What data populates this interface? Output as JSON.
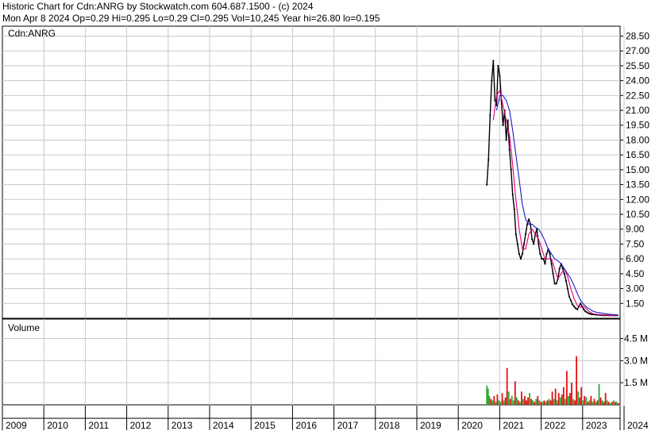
{
  "header": {
    "line1": "Historic Chart for Cdn:ANRG by Stockwatch.com 604.687.1500 - (c) 2024",
    "line2": "Mon Apr  8 2024  Op=0.29  Hi=0.295  Lo=0.29  Cl=0.295  Vol=10,245  Year hi=26.80  lo=0.195"
  },
  "colors": {
    "grid": "#c8c8c8",
    "price": "#000000",
    "ma_short": "#e0007a",
    "ma_long": "#1a1acc",
    "vol_up": "#2ea82e",
    "vol_down": "#e01010"
  },
  "chart_data": [
    {
      "type": "line",
      "panel": "price",
      "title": "Cdn:ANRG",
      "y_ticks": [
        "28.50",
        "27.00",
        "25.50",
        "24.00",
        "22.50",
        "21.00",
        "19.50",
        "18.00",
        "16.50",
        "15.00",
        "13.50",
        "12.00",
        "10.50",
        "9.00",
        "7.50",
        "6.00",
        "4.50",
        "3.00",
        "1.50"
      ],
      "ylim": [
        0,
        29.5
      ],
      "xlim": [
        2009,
        2024.3
      ],
      "grid": true,
      "series": [
        {
          "role": "price",
          "x": [
            2021.0,
            2021.04,
            2021.08,
            2021.12,
            2021.16,
            2021.2,
            2021.24,
            2021.28,
            2021.32,
            2021.36,
            2021.4,
            2021.44,
            2021.48,
            2021.52,
            2021.56,
            2021.6,
            2021.64,
            2021.68,
            2021.72,
            2021.76,
            2021.8,
            2021.84,
            2021.88,
            2021.92,
            2021.96,
            2022.0,
            2022.04,
            2022.08,
            2022.12,
            2022.16,
            2022.2,
            2022.24,
            2022.28,
            2022.32,
            2022.36,
            2022.4,
            2022.44,
            2022.48,
            2022.52,
            2022.56,
            2022.6,
            2022.64,
            2022.68,
            2022.72,
            2022.76,
            2022.8,
            2022.84,
            2022.88,
            2022.92,
            2022.96,
            2023.0,
            2023.04,
            2023.08,
            2023.12,
            2023.16,
            2023.2,
            2023.24,
            2023.28,
            2023.32,
            2023.36,
            2023.4,
            2023.44,
            2023.48,
            2023.52,
            2023.56,
            2023.6,
            2023.64,
            2023.68,
            2023.72,
            2023.76,
            2023.8,
            2023.84,
            2023.88,
            2023.92,
            2023.96,
            2024.0,
            2024.04,
            2024.08,
            2024.12,
            2024.16,
            2024.2,
            2024.24
          ],
          "y": [
            13.5,
            16.0,
            20.5,
            24.0,
            26.0,
            22.0,
            21.5,
            25.5,
            24.5,
            22.0,
            19.5,
            21.0,
            18.0,
            20.0,
            17.0,
            15.0,
            12.5,
            11.0,
            8.5,
            7.5,
            6.5,
            6.0,
            6.5,
            7.5,
            8.5,
            9.5,
            10.0,
            9.5,
            8.0,
            7.5,
            8.5,
            9.0,
            7.5,
            6.5,
            6.0,
            6.0,
            5.5,
            6.5,
            7.0,
            6.5,
            5.5,
            4.5,
            3.5,
            3.5,
            4.0,
            5.0,
            5.5,
            5.0,
            4.5,
            3.8,
            3.0,
            2.2,
            1.8,
            1.4,
            1.2,
            1.0,
            0.9,
            1.2,
            1.5,
            1.2,
            0.9,
            0.7,
            0.6,
            0.5,
            0.45,
            0.4,
            0.4,
            0.38,
            0.35,
            0.35,
            0.33,
            0.32,
            0.3,
            0.3,
            0.3,
            0.3,
            0.29,
            0.3,
            0.3,
            0.29,
            0.295,
            0.295
          ]
        },
        {
          "role": "ma_short",
          "x": [
            2021.16,
            2021.24,
            2021.32,
            2021.4,
            2021.48,
            2021.56,
            2021.64,
            2021.72,
            2021.8,
            2021.88,
            2021.96,
            2022.04,
            2022.12,
            2022.2,
            2022.28,
            2022.36,
            2022.44,
            2022.52,
            2022.6,
            2022.68,
            2022.76,
            2022.84,
            2022.92,
            2023.0,
            2023.08,
            2023.16,
            2023.24,
            2023.32,
            2023.4,
            2023.48,
            2023.56,
            2023.64,
            2023.72,
            2023.8,
            2023.88,
            2023.96,
            2024.04,
            2024.12,
            2024.2,
            2024.24
          ],
          "y": [
            20.0,
            22.5,
            23.0,
            21.5,
            20.0,
            18.5,
            15.5,
            12.0,
            9.0,
            7.0,
            7.0,
            8.5,
            9.0,
            8.5,
            8.0,
            7.0,
            6.0,
            6.0,
            6.0,
            5.0,
            4.0,
            4.5,
            5.0,
            4.2,
            3.0,
            2.0,
            1.3,
            1.1,
            1.2,
            0.9,
            0.6,
            0.45,
            0.4,
            0.36,
            0.33,
            0.31,
            0.3,
            0.3,
            0.3,
            0.3
          ]
        },
        {
          "role": "ma_long",
          "x": [
            2021.24,
            2021.32,
            2021.4,
            2021.48,
            2021.56,
            2021.64,
            2021.72,
            2021.8,
            2021.88,
            2021.96,
            2022.04,
            2022.12,
            2022.2,
            2022.28,
            2022.36,
            2022.44,
            2022.52,
            2022.6,
            2022.68,
            2022.76,
            2022.84,
            2022.92,
            2023.0,
            2023.08,
            2023.16,
            2023.24,
            2023.32,
            2023.4,
            2023.48,
            2023.56,
            2023.64,
            2023.72,
            2023.8,
            2023.88,
            2023.96,
            2024.04,
            2024.12,
            2024.2,
            2024.24
          ],
          "y": [
            21.0,
            22.5,
            22.5,
            22.0,
            21.0,
            19.0,
            16.5,
            14.0,
            11.5,
            10.0,
            9.5,
            9.5,
            9.2,
            9.0,
            8.5,
            7.8,
            7.0,
            6.5,
            6.0,
            5.8,
            5.5,
            5.0,
            4.5,
            4.0,
            3.3,
            2.5,
            1.8,
            1.4,
            1.1,
            0.9,
            0.7,
            0.6,
            0.55,
            0.5,
            0.45,
            0.4,
            0.38,
            0.35,
            0.33
          ]
        }
      ]
    },
    {
      "type": "bar",
      "panel": "volume",
      "title": "Volume",
      "y_ticks": [
        "4.5 M",
        "3.0 M",
        "1.5 M"
      ],
      "ylim": [
        0,
        5.5
      ],
      "xlim": [
        2009,
        2024.3
      ],
      "grid": true,
      "series": [
        {
          "name": "volume",
          "x": [
            2021.0,
            2021.03,
            2021.06,
            2021.1,
            2021.14,
            2021.18,
            2021.22,
            2021.26,
            2021.3,
            2021.34,
            2021.38,
            2021.42,
            2021.46,
            2021.5,
            2021.54,
            2021.58,
            2021.62,
            2021.66,
            2021.7,
            2021.74,
            2021.78,
            2021.82,
            2021.86,
            2021.9,
            2021.94,
            2021.98,
            2022.02,
            2022.06,
            2022.1,
            2022.14,
            2022.18,
            2022.22,
            2022.26,
            2022.3,
            2022.34,
            2022.38,
            2022.42,
            2022.46,
            2022.5,
            2022.54,
            2022.58,
            2022.62,
            2022.66,
            2022.7,
            2022.74,
            2022.78,
            2022.82,
            2022.86,
            2022.9,
            2022.94,
            2022.98,
            2023.02,
            2023.06,
            2023.1,
            2023.14,
            2023.18,
            2023.22,
            2023.26,
            2023.3,
            2023.34,
            2023.38,
            2023.42,
            2023.46,
            2023.5,
            2023.54,
            2023.58,
            2023.62,
            2023.66,
            2023.7,
            2023.74,
            2023.78,
            2023.82,
            2023.86,
            2023.9,
            2023.94,
            2023.98,
            2024.02,
            2024.06,
            2024.1,
            2024.14,
            2024.18,
            2024.22,
            2024.26
          ],
          "values": [
            1.3,
            1.1,
            0.6,
            0.4,
            0.3,
            0.6,
            0.2,
            0.7,
            0.3,
            0.2,
            0.8,
            0.3,
            0.5,
            2.5,
            0.9,
            0.4,
            0.6,
            0.3,
            1.6,
            0.5,
            0.3,
            0.2,
            0.9,
            0.4,
            0.6,
            0.3,
            0.5,
            0.8,
            0.4,
            0.3,
            0.2,
            0.4,
            0.6,
            0.3,
            0.2,
            0.2,
            0.3,
            0.2,
            0.3,
            0.4,
            0.3,
            0.9,
            0.4,
            1.1,
            0.3,
            0.8,
            0.5,
            0.7,
            1.2,
            0.4,
            2.3,
            0.6,
            0.8,
            1.5,
            0.4,
            0.3,
            3.3,
            0.9,
            0.5,
            1.2,
            0.3,
            0.6,
            0.5,
            0.2,
            0.3,
            0.6,
            0.2,
            0.4,
            0.2,
            0.3,
            1.4,
            0.5,
            0.3,
            0.2,
            0.8,
            0.3,
            0.2,
            0.1,
            0.2,
            0.3,
            0.2,
            0.2,
            0.1
          ],
          "up": [
            true,
            true,
            true,
            false,
            true,
            false,
            true,
            false,
            true,
            true,
            false,
            true,
            false,
            false,
            true,
            false,
            true,
            true,
            false,
            true,
            false,
            true,
            false,
            true,
            false,
            false,
            false,
            true,
            false,
            true,
            false,
            true,
            false,
            true,
            false,
            true,
            false,
            true,
            false,
            true,
            false,
            false,
            true,
            false,
            true,
            false,
            true,
            false,
            false,
            true,
            false,
            true,
            false,
            false,
            true,
            false,
            false,
            true,
            false,
            false,
            true,
            false,
            true,
            false,
            true,
            false,
            true,
            false,
            true,
            false,
            true,
            false,
            true,
            false,
            false,
            true,
            false,
            true,
            false,
            true,
            false,
            true,
            false
          ]
        }
      ]
    },
    {
      "type": "axis",
      "panel": "years",
      "categories": [
        "2009",
        "2010",
        "2011",
        "2012",
        "2013",
        "2014",
        "2015",
        "2016",
        "2017",
        "2018",
        "2019",
        "2020",
        "2021",
        "2022",
        "2023",
        "2024"
      ]
    }
  ]
}
